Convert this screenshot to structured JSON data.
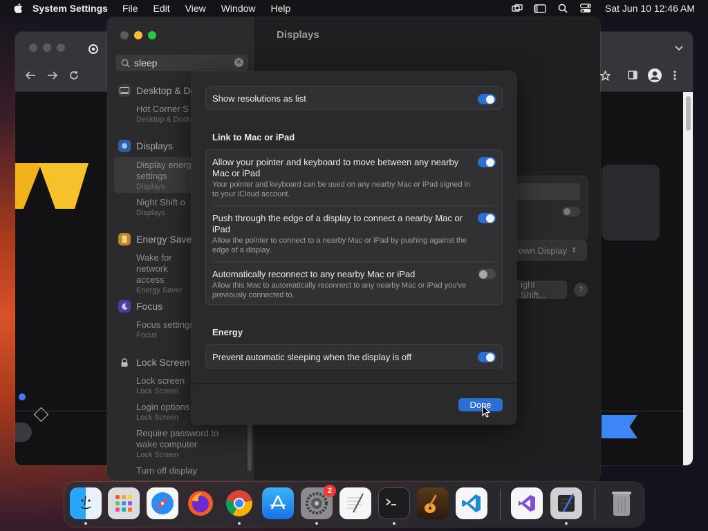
{
  "menubar": {
    "app_name": "System Settings",
    "items": [
      "File",
      "Edit",
      "View",
      "Window",
      "Help"
    ],
    "clock": "Sat Jun 10  12:46 AM"
  },
  "settings": {
    "window_title": "Displays",
    "search": {
      "value": "sleep"
    },
    "sidebar": {
      "groups": [
        {
          "label": "Desktop & Dock",
          "items": [
            {
              "title": "Hot Corner S",
              "subtitle": "Desktop & Dock"
            }
          ]
        },
        {
          "label": "Displays",
          "items": [
            {
              "title": "Display energy settings",
              "subtitle": "Displays"
            },
            {
              "title": "Night Shift o",
              "subtitle": "Displays"
            }
          ]
        },
        {
          "label": "Energy Saver",
          "items": [
            {
              "title": "Wake for network access",
              "subtitle": "Energy Saver"
            }
          ]
        },
        {
          "label": "Focus",
          "items": [
            {
              "title": "Focus settings",
              "subtitle": "Focus"
            }
          ]
        },
        {
          "label": "Lock Screen",
          "items": [
            {
              "title": "Lock screen",
              "subtitle": "Lock Screen"
            },
            {
              "title": "Login options",
              "subtitle": "Lock Screen"
            },
            {
              "title": "Require password to wake computer",
              "subtitle": "Lock Screen"
            },
            {
              "title": "Turn off display",
              "subtitle": ""
            }
          ]
        }
      ]
    },
    "main": {
      "dropdown_fragment": "own Display",
      "night_shift_fragment": "ight Shift...",
      "help_label": "?"
    }
  },
  "sheet": {
    "show_resolutions": {
      "label": "Show resolutions as list",
      "on": true
    },
    "link_section": "Link to Mac or iPad",
    "link_rows": [
      {
        "title": "Allow your pointer and keyboard to move between any nearby Mac or iPad",
        "desc": "Your pointer and keyboard can be used on any nearby Mac or iPad signed in to your iCloud account.",
        "on": true
      },
      {
        "title": "Push through the edge of a display to connect a nearby Mac or iPad",
        "desc": "Allow the pointer to connect to a nearby Mac or iPad by pushing against the edge of a display.",
        "on": true
      },
      {
        "title": "Automatically reconnect to any nearby Mac or iPad",
        "desc": "Allow this Mac to automatically reconnect to any nearby Mac or iPad you've previously connected to.",
        "on": false
      }
    ],
    "energy_section": "Energy",
    "energy_row": {
      "label": "Prevent automatic sleeping when the display is off",
      "on": true
    },
    "done_label": "Done"
  },
  "dock": {
    "apps": [
      "finder-icon",
      "launchpad-icon",
      "safari-icon",
      "firefox-icon",
      "chrome-icon",
      "app-store-icon",
      "system-settings-icon",
      "textedit-icon",
      "terminal-icon",
      "garageband-icon",
      "vscode-icon",
      "visual-studio-icon",
      "xcode-icon",
      "trash-icon"
    ],
    "settings_badge": "2"
  },
  "colors": {
    "accent": "#2b6fd4",
    "toggle_off": "#48484b"
  }
}
